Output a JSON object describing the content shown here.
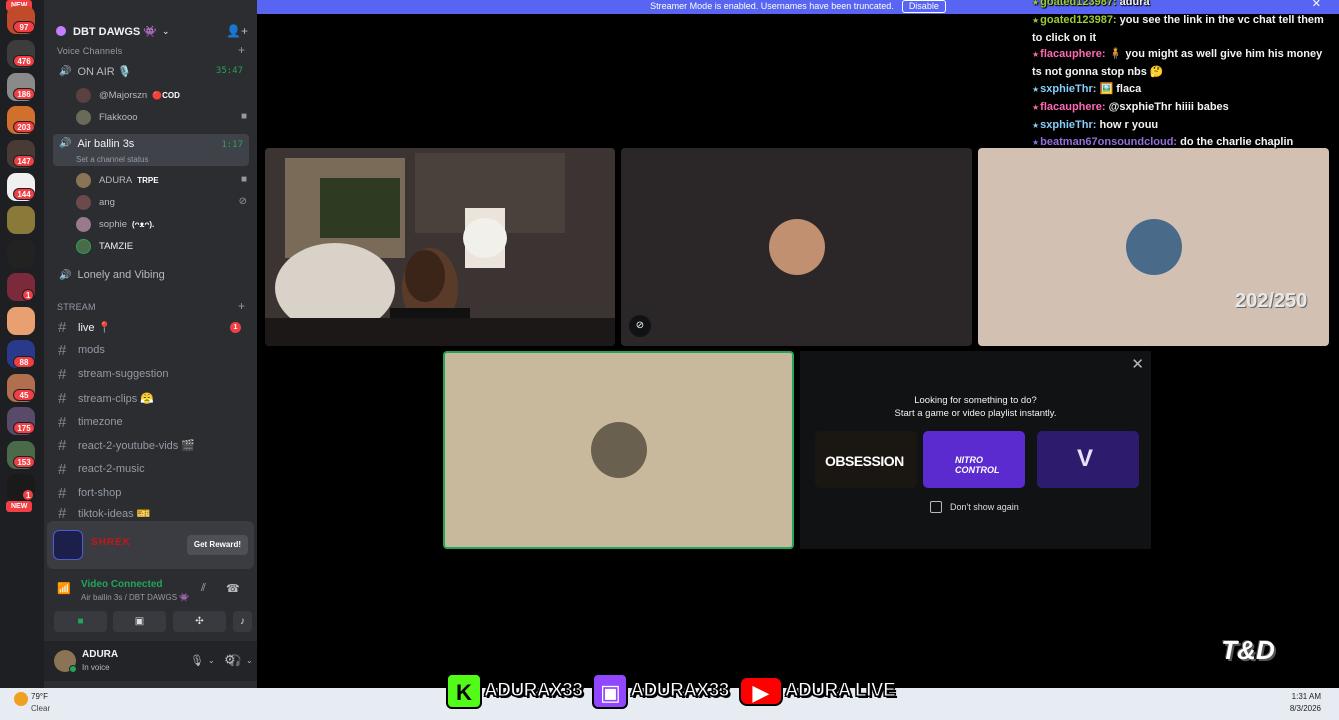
{
  "banner": {
    "text": "Streamer Mode is enabled. Usernames have been truncated.",
    "disable": "Disable"
  },
  "rail": {
    "new_top": "NEW",
    "new_bottom": "NEW",
    "badges": [
      "97",
      "476",
      "186",
      "203",
      "147",
      "144",
      "1",
      "88",
      "45",
      "175",
      "153",
      "1"
    ]
  },
  "server": {
    "name": "DBT DAWGS 👾"
  },
  "voice": {
    "category": "Voice Channels",
    "channels": [
      {
        "name": "ON AIR 🎙️",
        "timer": "35:47"
      },
      {
        "name": "Air ballin 3s",
        "timer": "1:17",
        "status": "Set a channel status"
      },
      {
        "name": "Lonely and Vibing"
      }
    ],
    "on_air_users": [
      {
        "name": "@Majorszn",
        "tag": "🔴COD"
      },
      {
        "name": "Flakkooo"
      }
    ],
    "air_users": [
      {
        "name": "ADURA",
        "tag": "TRPE"
      },
      {
        "name": "ang"
      },
      {
        "name": "sophie",
        "tag": "(ᴖᴥᴖ)."
      },
      {
        "name": "TAMZIE"
      }
    ]
  },
  "stream": {
    "category": "STREAM",
    "channels": [
      "live 📍",
      "mods",
      "stream-suggestion",
      "stream-clips 😤",
      "timezone",
      "react-2-youtube-vids 🎬",
      "react-2-music",
      "fort-shop",
      "tiktok-ideas 🎫"
    ],
    "live_unread": "1"
  },
  "promo": {
    "art_text": "SHREK",
    "button": "Get Reward!"
  },
  "voice_panel": {
    "connected": "Video Connected",
    "channel": "Air ballin 3s / DBT DAWGS 👾"
  },
  "user": {
    "name": "ADURA",
    "status": "In voice"
  },
  "tiles": {
    "counter": "202/250"
  },
  "activity": {
    "line1": "Looking for something to do?",
    "line2": "Start a game or video playlist instantly.",
    "games": [
      "OBSESSION",
      "NITRO CONTROL",
      "V"
    ],
    "checkbox": "Don't show again"
  },
  "chat": [
    {
      "user": "goated123987",
      "text": "adura",
      "color": "#9acd32"
    },
    {
      "user": "goated123987",
      "text": "you see the link in the vc chat tell them to click on it",
      "color": "#9acd32"
    },
    {
      "user": "flacauphere",
      "text": "🧍 you might as well give him his money ts not gonna stop nbs 🤔",
      "color": "#ff69b4"
    },
    {
      "user": "sxphieThr",
      "text": "🖼️ flaca",
      "color": "#87cefa"
    },
    {
      "user": "flacauphere",
      "text": "@sxphieThr hiiii babes",
      "color": "#ff69b4"
    },
    {
      "user": "sxphieThr",
      "text": "how r youu",
      "color": "#87cefa"
    },
    {
      "user": "beatman67onsoundcloud",
      "text": "do the charlie chaplin",
      "color": "#9370db"
    }
  ],
  "socials": [
    {
      "logo": "K",
      "handle": "ADURAX33",
      "color": "#53fc18"
    },
    {
      "logo": "▣",
      "handle": "ADURAX33",
      "color": "#9146ff"
    },
    {
      "logo": "▶",
      "handle": "ADURA LIVE",
      "color": "#ff0000"
    }
  ],
  "watermark": "T&D",
  "taskbar": {
    "temp": "79°F",
    "cond": "Clear",
    "time": "1:31 AM",
    "date": "8/3/2026"
  },
  "colors": {
    "accent": "#5865f2",
    "online": "#23a559",
    "danger": "#f23f43"
  }
}
